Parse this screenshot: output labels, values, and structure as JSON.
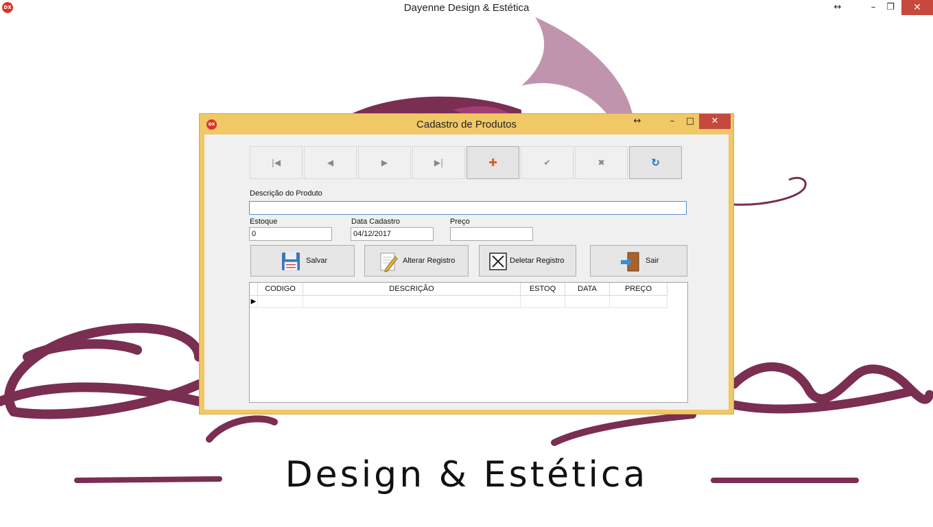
{
  "window": {
    "title": "Dayenne Design & Estética",
    "icon_text": "DX"
  },
  "background": {
    "tagline": "Design & Estética",
    "brand_color": "#7a2e52",
    "accent_color": "#c194ad"
  },
  "dialog": {
    "title": "Cadastro de Produtos",
    "icon_text": "DX",
    "navigator": [
      "first",
      "prior",
      "next",
      "last",
      "insert",
      "post",
      "cancel",
      "refresh"
    ],
    "labels": {
      "descricao": "Descrição do Produto",
      "estoque": "Estoque",
      "data_cadastro": "Data Cadastro",
      "preco": "Preço"
    },
    "fields": {
      "descricao": "",
      "estoque": "0",
      "data_cadastro": "04/12/2017",
      "preco": ""
    },
    "buttons": {
      "salvar": "Salvar",
      "alterar": "Alterar Registro",
      "deletar": "Deletar Registro",
      "sair": "Sair"
    },
    "grid": {
      "columns": [
        "CODIGO",
        "DESCRIÇÃO",
        "ESTOQ",
        "DATA",
        "PREÇO"
      ],
      "rows": []
    }
  }
}
